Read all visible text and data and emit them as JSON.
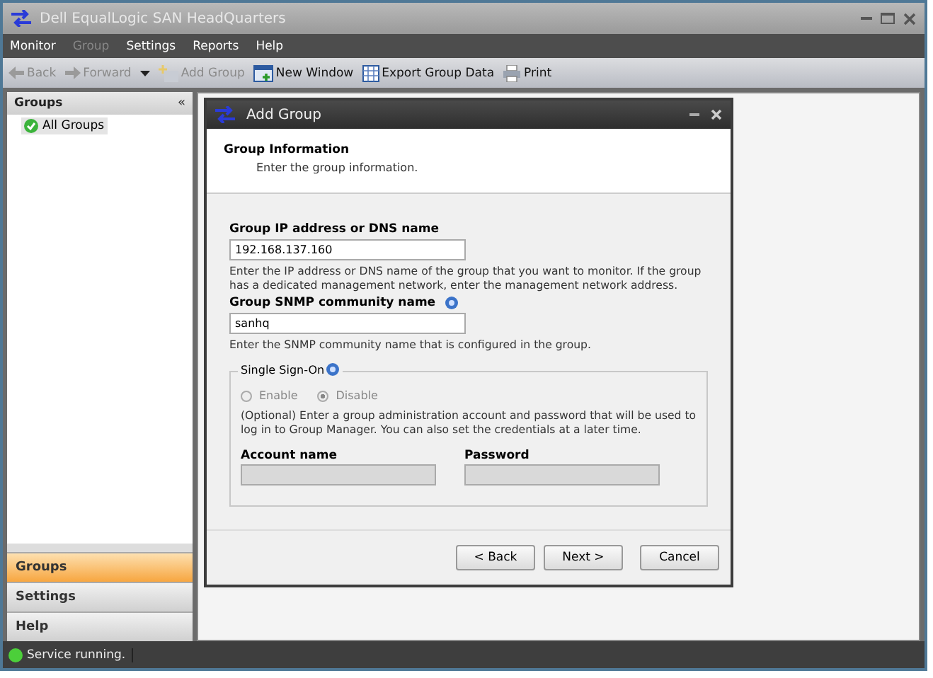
{
  "window": {
    "title": "Dell EqualLogic SAN HeadQuarters"
  },
  "menu": [
    {
      "label": "Monitor",
      "disabled": false
    },
    {
      "label": "Group",
      "disabled": true
    },
    {
      "label": "Settings",
      "disabled": false
    },
    {
      "label": "Reports",
      "disabled": false
    },
    {
      "label": "Help",
      "disabled": false
    }
  ],
  "toolbar": [
    {
      "kind": "back",
      "label": "Back",
      "disabled": true
    },
    {
      "kind": "forward",
      "label": "Forward",
      "disabled": true
    },
    {
      "kind": "dropdown"
    },
    {
      "kind": "add",
      "label": "Add Group",
      "disabled": true
    },
    {
      "kind": "window",
      "label": "New Window",
      "disabled": false
    },
    {
      "kind": "export",
      "label": "Export Group Data",
      "disabled": false
    },
    {
      "kind": "print",
      "label": "Print",
      "disabled": false
    }
  ],
  "sidebar": {
    "title": "Groups",
    "collapse": "«",
    "tree": [
      {
        "label": "All Groups",
        "selected": true
      }
    ],
    "nav": [
      {
        "label": "Groups",
        "selected": true
      },
      {
        "label": "Settings",
        "selected": false
      },
      {
        "label": "Help",
        "selected": false
      }
    ]
  },
  "dialog": {
    "title": "Add Group",
    "heading": "Group Information",
    "subheading": "Enter the group information.",
    "fields": [
      {
        "label": "Group IP address or DNS name",
        "help_icon": false,
        "value": "192.168.137.160",
        "hint": "Enter the IP address or DNS name of the group that you want to monitor.  If the group has a dedicated management network, enter the management network address."
      },
      {
        "label": "Group SNMP community name",
        "help_icon": true,
        "value": "sanhq",
        "hint": "Enter the SNMP community name that is configured in the group."
      }
    ],
    "sso": {
      "title": "Single Sign-On",
      "options": [
        {
          "label": "Enable",
          "selected": false,
          "disabled": true
        },
        {
          "label": "Disable",
          "selected": true,
          "disabled": true
        }
      ],
      "text": "(Optional) Enter a group administration account and password that will be used to log in to Group Manager. You can also set the credentials at a later time.",
      "inputs": [
        {
          "label": "Account name",
          "disabled": true
        },
        {
          "label": "Password",
          "disabled": true
        }
      ]
    },
    "buttons": [
      "< Back",
      "Next >",
      "Cancel"
    ]
  },
  "status": {
    "text": "Service running."
  }
}
